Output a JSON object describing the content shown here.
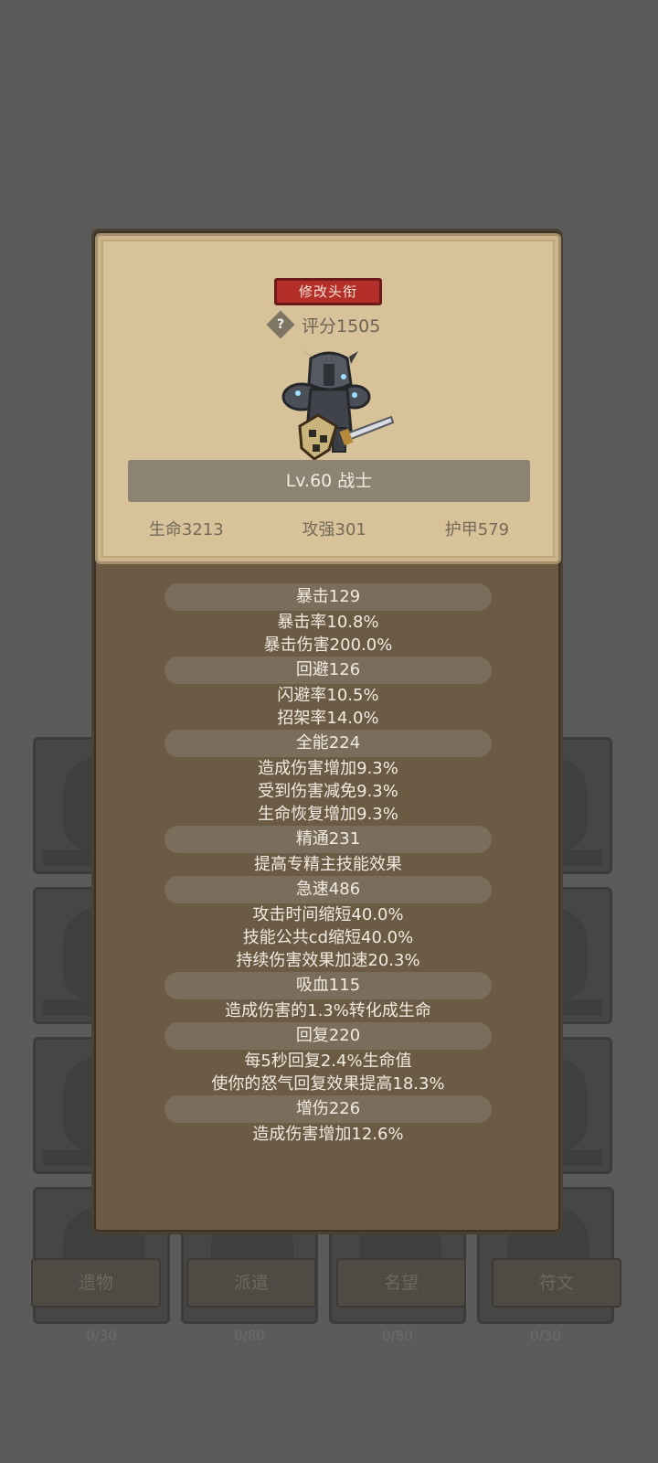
{
  "title_button": "修改头衔",
  "score": "评分1505",
  "help_symbol": "?",
  "name": "Lv.60 战士",
  "base_stats": [
    "生命3213",
    "攻强301",
    "护甲579"
  ],
  "attributes": [
    {
      "head": "暴击129",
      "lines": [
        "暴击率10.8%",
        "暴击伤害200.0%"
      ]
    },
    {
      "head": "回避126",
      "lines": [
        "闪避率10.5%",
        "招架率14.0%"
      ]
    },
    {
      "head": "全能224",
      "lines": [
        "造成伤害增加9.3%",
        "受到伤害减免9.3%",
        "生命恢复增加9.3%"
      ]
    },
    {
      "head": "精通231",
      "lines": [
        "提高专精主技能效果"
      ]
    },
    {
      "head": "急速486",
      "lines": [
        "攻击时间缩短40.0%",
        "技能公共cd缩短40.0%",
        "持续伤害效果加速20.3%"
      ]
    },
    {
      "head": "吸血115",
      "lines": [
        "造成伤害的1.3%转化成生命"
      ]
    },
    {
      "head": "回复220",
      "lines": [
        "每5秒回复2.4%生命值",
        "使你的怒气回复效果提高18.3%"
      ]
    },
    {
      "head": "增伤226",
      "lines": [
        "造成伤害增加12.6%"
      ]
    }
  ],
  "background": {
    "tabs": [
      "遗物",
      "派遣",
      "名望",
      "符文"
    ],
    "counts": [
      "0/30",
      "0/80",
      "0/80",
      "0/30"
    ]
  },
  "colors": {
    "accent_red": "#b42e2a",
    "parchment": "#d7c29a",
    "panel_brown": "#6b5a44"
  }
}
